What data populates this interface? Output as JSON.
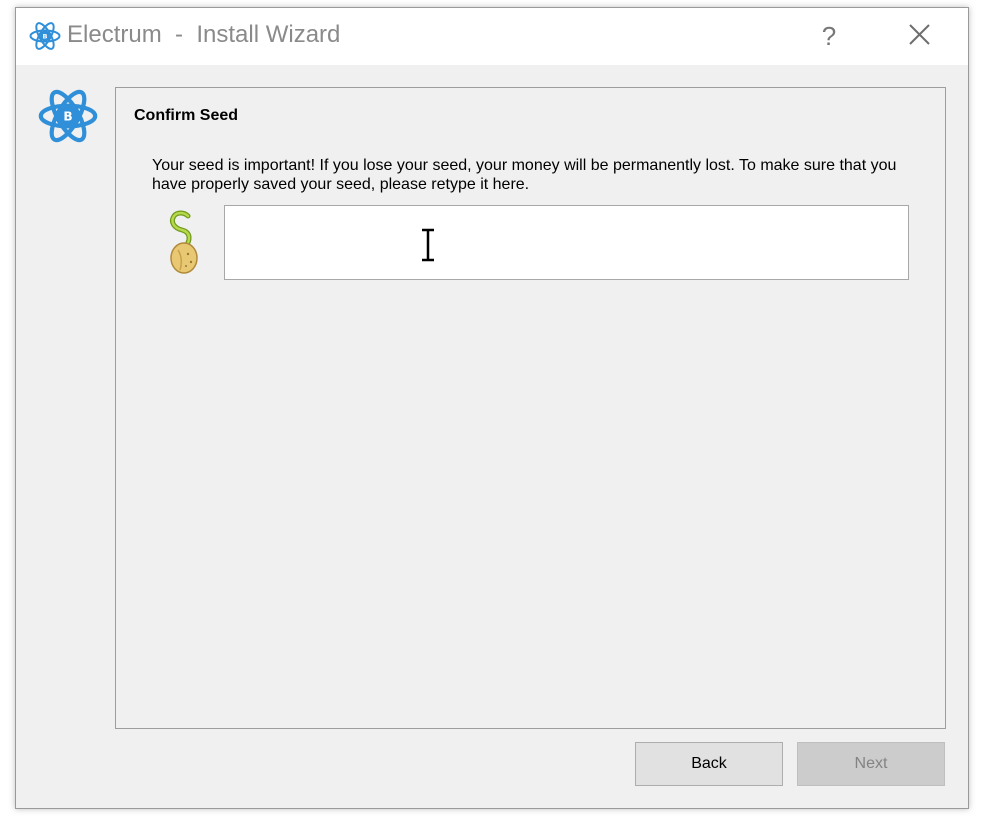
{
  "window": {
    "title": "Electrum  -  Install Wizard",
    "help_label": "?",
    "close_icon": "close-icon",
    "app_icon": "electrum-logo-icon"
  },
  "panel": {
    "title": "Confirm Seed",
    "message": "Your seed is important! If you lose your seed, your money will be permanently lost. To make sure that you have properly saved your seed, please retype it here.",
    "seed_icon": "seed-sprout-icon",
    "seed_input_value": ""
  },
  "buttons": {
    "back_label": "Back",
    "next_label": "Next",
    "next_enabled": false
  },
  "colors": {
    "brand_blue": "#2f8fd8",
    "title_text": "#8a8a8a",
    "window_bg": "#f0f0f0"
  }
}
